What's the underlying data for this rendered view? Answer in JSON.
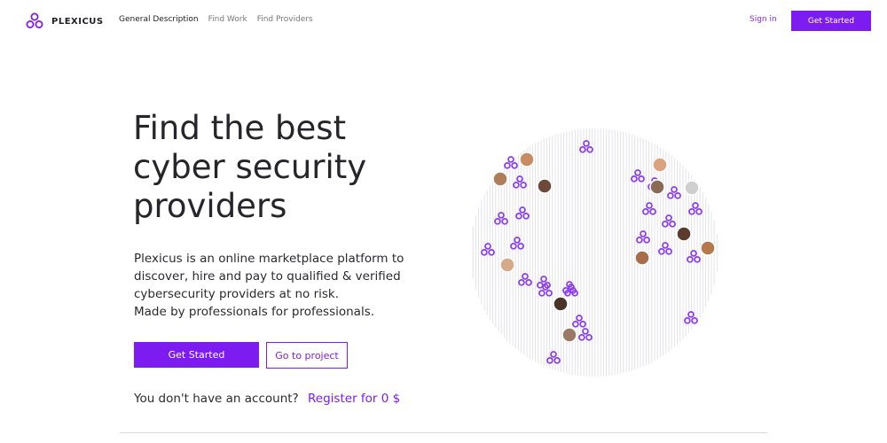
{
  "brand": {
    "name": "PLEXICUS"
  },
  "nav": {
    "items": [
      {
        "label": "General Description",
        "active": true
      },
      {
        "label": "Find Work",
        "active": false
      },
      {
        "label": "Find Providers",
        "active": false
      }
    ],
    "sign_in": "Sign in",
    "get_started": "Get Started"
  },
  "hero": {
    "headline_lines": [
      "Find the best",
      "cyber security",
      "providers"
    ],
    "description_lines": [
      "Plexicus is an online marketplace platform to",
      "discover, hire and pay to qualified & verified",
      "cybersecurity providers at no risk.",
      "Made by professionals for professionals."
    ],
    "primary_button": "Get Started",
    "secondary_button": "Go to project",
    "account_prompt": "You don't have an account?",
    "register_link": "Register for 0 $"
  },
  "illustration": {
    "icon": "globe-with-logo-markers-and-avatars-icon"
  },
  "colors": {
    "accent": "#7c1cf0",
    "text": "#25252b",
    "muted": "#777780"
  }
}
